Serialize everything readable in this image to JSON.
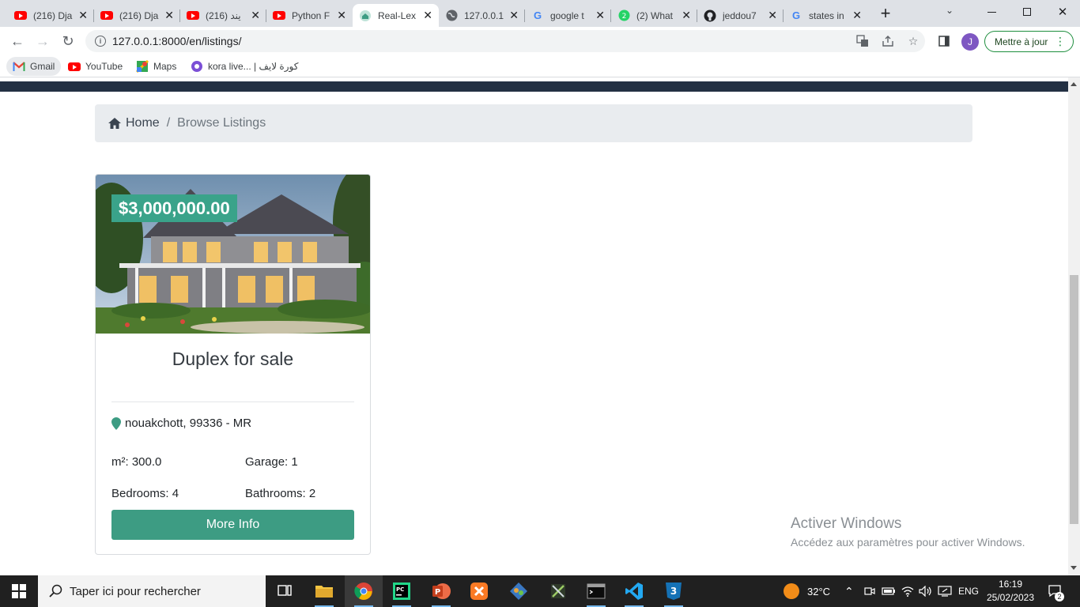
{
  "browser": {
    "tabs": [
      {
        "title": "(216) Dja",
        "icon": "youtube-icon"
      },
      {
        "title": "(216) Dja",
        "icon": "youtube-icon"
      },
      {
        "title": "(216) يند",
        "icon": "youtube-icon"
      },
      {
        "title": "Python F",
        "icon": "youtube-icon"
      },
      {
        "title": "Real-Lex",
        "icon": "house-icon"
      },
      {
        "title": "127.0.0.1",
        "icon": "globe-icon"
      },
      {
        "title": "google t",
        "icon": "google-icon"
      },
      {
        "title": "(2) What",
        "icon": "whatsapp-icon"
      },
      {
        "title": "jeddou7",
        "icon": "github-icon"
      },
      {
        "title": "states in",
        "icon": "google-icon"
      }
    ],
    "new_tab": "+",
    "url": "127.0.0.1:8000/en/listings/",
    "profile_initial": "J",
    "update_label": "Mettre à jour",
    "bookmarks": [
      {
        "label": "Gmail",
        "icon": "gmail-icon"
      },
      {
        "label": "YouTube",
        "icon": "youtube-icon"
      },
      {
        "label": "Maps",
        "icon": "maps-icon"
      },
      {
        "label": "kora live... | كورة لايف",
        "icon": "kora-icon"
      }
    ]
  },
  "breadcrumb": {
    "home": "Home",
    "separator": "/",
    "current": "Browse Listings"
  },
  "listing": {
    "price": "$3,000,000.00",
    "title": "Duplex for sale",
    "location": "nouakchott, 99336 - MR",
    "area": "m²: 300.0",
    "garage": "Garage: 1",
    "bedrooms": "Bedrooms: 4",
    "bathrooms": "Bathrooms: 2",
    "button": "More Info"
  },
  "watermark": {
    "title": "Activer Windows",
    "subtitle": "Accédez aux paramètres pour activer Windows."
  },
  "taskbar": {
    "search_placeholder": "Taper ici pour rechercher",
    "weather": "32°C",
    "language": "ENG",
    "time": "16:19",
    "date": "25/02/2023",
    "notifications": "2"
  },
  "colors": {
    "accent": "#3d9c83",
    "price_badge": "#3aa38a",
    "navbar": "#233043"
  }
}
